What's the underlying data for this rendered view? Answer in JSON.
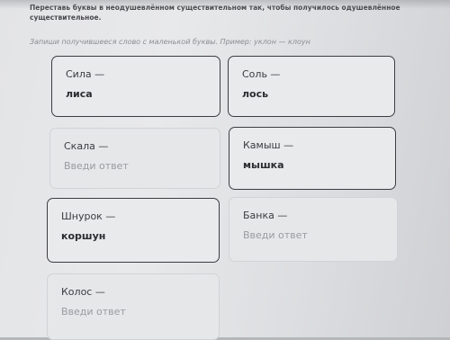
{
  "instruction": "Переставь буквы в неодушевлённом существительном так, чтобы получилось одушевлённое существительное.",
  "hint": "Запиши получившееся слово с маленькой буквы. Пример: уклон — клоун",
  "cards": [
    {
      "word": "Сила —",
      "answer": "лиса",
      "placeholder": "Введи ответ"
    },
    {
      "word": "Соль —",
      "answer": "лось",
      "placeholder": "Введи ответ"
    },
    {
      "word": "Скала —",
      "answer": "",
      "placeholder": "Введи ответ"
    },
    {
      "word": "Камыш —",
      "answer": "мышка",
      "placeholder": "Введи ответ"
    },
    {
      "word": "Шнурок —",
      "answer": "коршун",
      "placeholder": "Введи ответ"
    },
    {
      "word": "Банка —",
      "answer": "",
      "placeholder": "Введи ответ"
    },
    {
      "word": "Колос —",
      "answer": "",
      "placeholder": "Введи ответ"
    }
  ]
}
